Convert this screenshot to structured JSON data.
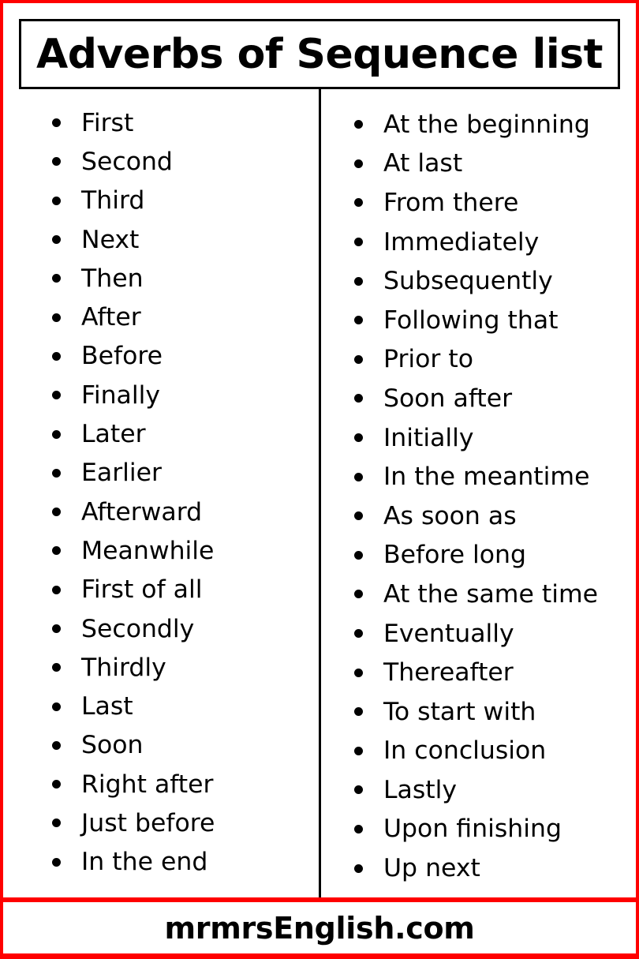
{
  "title": "Adverbs of Sequence list",
  "colors": {
    "border": "#ff0000",
    "text": "#000000",
    "background": "#ffffff"
  },
  "left_column": [
    "First",
    "Second",
    "Third",
    "Next",
    "Then",
    "After",
    "Before",
    "Finally",
    "Later",
    "Earlier",
    "Afterward",
    "Meanwhile",
    "First of all",
    "Secondly",
    "Thirdly",
    "Last",
    "Soon",
    "Right after",
    "Just before",
    "In the end"
  ],
  "right_column": [
    "At the beginning",
    "At last",
    "From there",
    "Immediately",
    "Subsequently",
    "Following that",
    "Prior to",
    "Soon after",
    "Initially",
    "In the meantime",
    "As soon as",
    "Before long",
    "At the same time",
    "Eventually",
    "Thereafter",
    "To start with",
    "In conclusion",
    "Lastly",
    "Upon finishing",
    "Up next"
  ],
  "footer": "mrmrsEnglish.com"
}
